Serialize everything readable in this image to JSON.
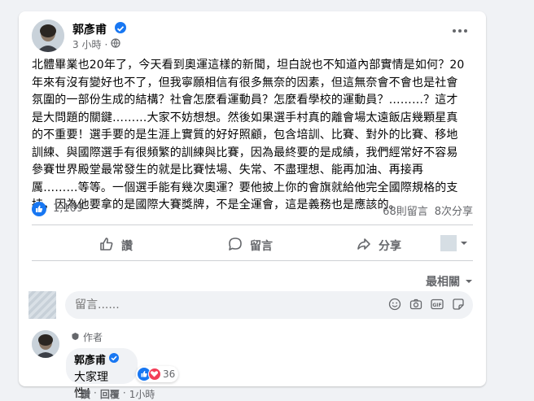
{
  "post": {
    "author": "郭彥甫",
    "time": "3 小時",
    "separator": "·",
    "body_lines": [
      "北體畢業也20年了，今天看到奧運這樣的新聞，坦白說也不知道內部實情是如何？20",
      "年來有沒有變好也不了，但我寧願相信有很多無奈的因素，但這無奈會不會也是社會",
      "氛圍的一部份生成的結構？社會怎麼看運動員？怎麼看學校的運動員？………？這才",
      "是大問題的關鍵………大家不妨想想。然後如果選手村真的離會場太遠飯店幾顆星真",
      "的不重要！選手要的是生涯上實質的好好照顧，包含培訓、比賽、對外的比賽、移地",
      "訓練、與國際選手有很頻繁的訓練與比賽，因為最終要的是成績，我們經常好不容易",
      "參賽世界殿堂最常發生的就是比賽怯場、失常、不盡理想、能再加油、再接再",
      "厲………等等。一個選手能有幾次奧運？要他披上你的會旗就給他完全國際規格的支",
      "持，因為他要拿的是國際大賽獎牌，不是全運會，這是義務也是應該的。"
    ],
    "reactions_count": "1,109",
    "comments_count": "68則留言",
    "shares_count": "8次分享"
  },
  "actions": {
    "like": "讚",
    "comment": "留言",
    "share": "分享"
  },
  "sort_label": "最相關",
  "compose": {
    "placeholder": "留言......"
  },
  "comment": {
    "author_tag": "作者",
    "author": "郭彥甫",
    "text": "大家理性！",
    "reactions": "36",
    "like_action": "讚",
    "reply_action": "回覆",
    "time": "1小時",
    "dot": "·"
  },
  "colors": {
    "brand_blue": "#1877f2",
    "love_red": "#f33e58",
    "secondary_text": "#65676b"
  }
}
